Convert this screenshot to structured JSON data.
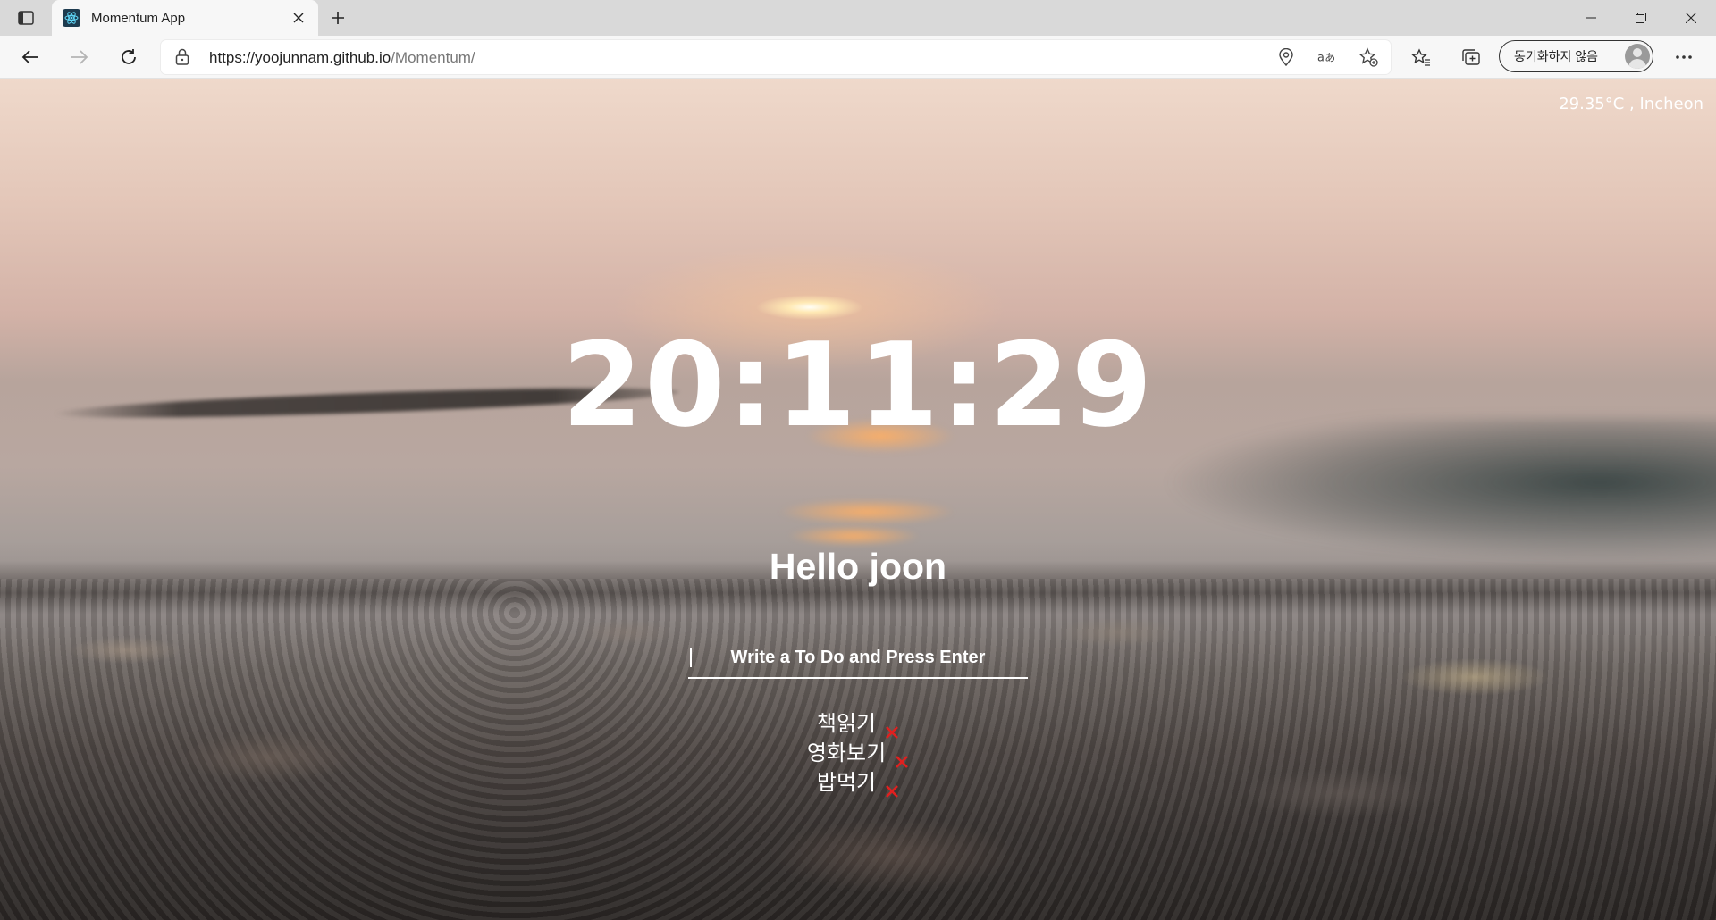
{
  "browser": {
    "tab_title": "Momentum App",
    "url_host": "https://yoojunnam.github.io",
    "url_path": "/Momentum/",
    "profile_label": "동기화하지 않음",
    "icons": {
      "sidebar": "tab-actions-icon",
      "favicon": "react-atom-icon",
      "close": "close-icon",
      "new_tab": "plus-icon",
      "back": "back-arrow-icon",
      "forward": "forward-arrow-icon",
      "refresh": "refresh-icon",
      "lock": "lock-icon",
      "location": "location-icon",
      "translate": "translate-icon",
      "add_favorite": "star-add-icon",
      "favorites": "favorites-icon",
      "collections": "collections-icon",
      "menu": "more-icon"
    }
  },
  "page": {
    "weather": "29.35°C , Incheon",
    "clock": "20:11:29",
    "greeting": "Hello joon",
    "todo_placeholder": "Write a To Do and Press Enter",
    "todos": [
      {
        "text": "책읽기"
      },
      {
        "text": "영화보기"
      },
      {
        "text": "밥먹기"
      }
    ],
    "colors": {
      "delete_icon": "#e0201f",
      "text": "#ffffff"
    }
  }
}
